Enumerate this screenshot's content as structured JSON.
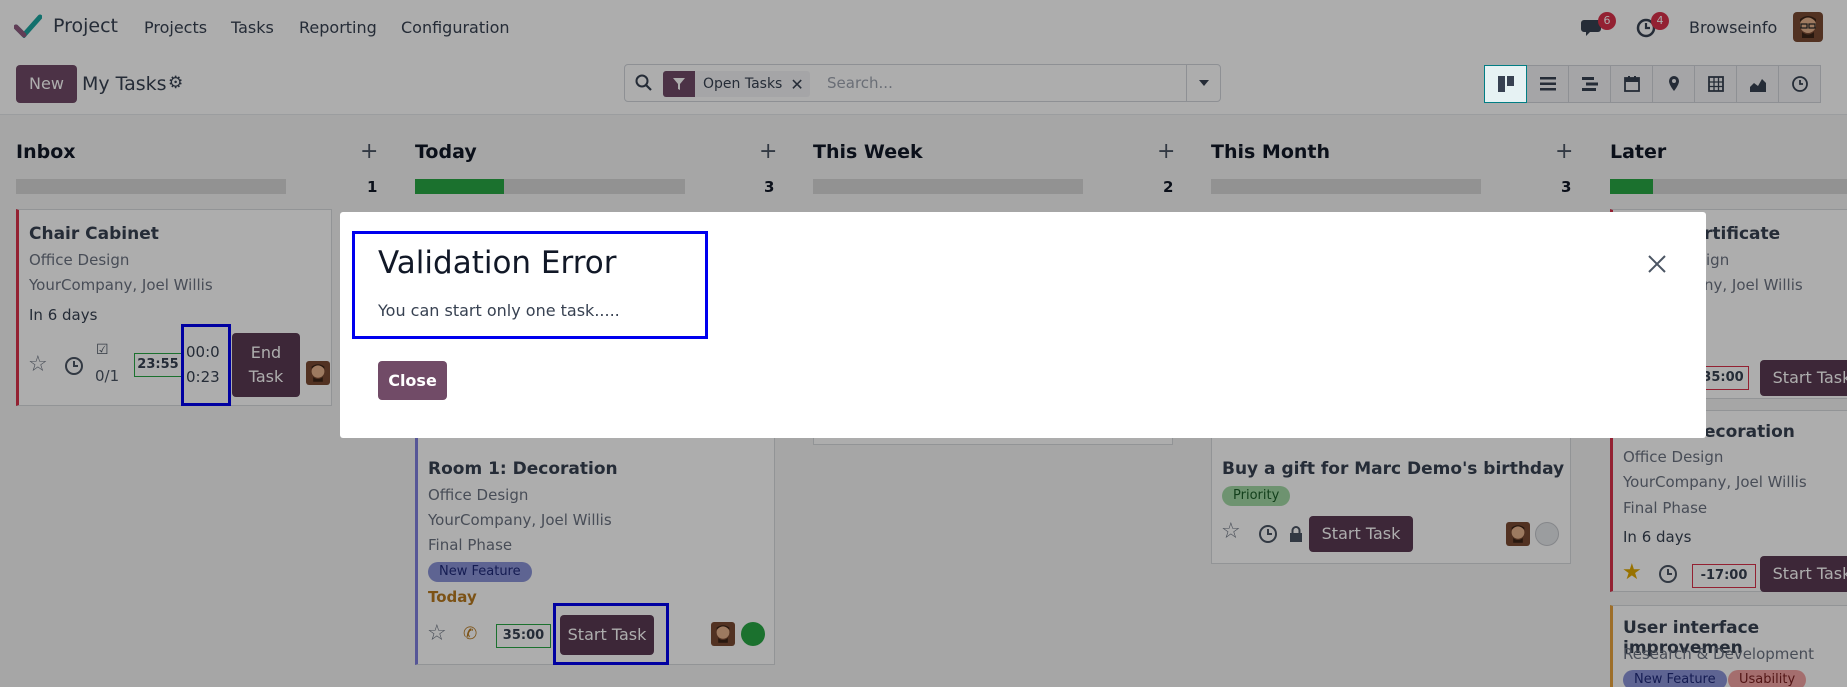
{
  "app": {
    "name": "Project"
  },
  "menu": {
    "items": [
      "Projects",
      "Tasks",
      "Reporting",
      "Configuration"
    ]
  },
  "systray": {
    "messages_count": "6",
    "activities_count": "4",
    "user": "Browseinfo"
  },
  "control": {
    "new_label": "New",
    "title": "My Tasks",
    "search": {
      "facet": "Open Tasks",
      "placeholder": "Search..."
    },
    "views": [
      "kanban",
      "list",
      "gantt",
      "calendar",
      "map",
      "pivot",
      "graph",
      "activity"
    ]
  },
  "columns": [
    {
      "title": "Inbox",
      "count": "1",
      "progress": 0
    },
    {
      "title": "Today",
      "count": "3",
      "progress": 0.33
    },
    {
      "title": "This Week",
      "count": "2",
      "progress": 0
    },
    {
      "title": "This Month",
      "count": "3",
      "progress": 0
    },
    {
      "title": "Later",
      "count": "",
      "progress": 0.18
    }
  ],
  "cards": {
    "chair": {
      "title": "Chair Cabinet",
      "project": "Office Design",
      "customer": "YourCompany, Joel Willis",
      "deadline": "In 6 days",
      "subtasks": "0/1",
      "planned": "23:55",
      "timer_a": "00:0",
      "timer_b": "0:23",
      "end_a": "End",
      "end_b": "Task"
    },
    "room1": {
      "title": "Room 1: Decoration",
      "project": "Office Design",
      "customer": "YourCompany, Joel Willis",
      "stage": "Final Phase",
      "tag": "New Feature",
      "deadline": "Today",
      "planned": "35:00",
      "start": "Start Task"
    },
    "gift": {
      "title": "Buy a gift for Marc Demo's birthday",
      "tag": "Priority",
      "start": "Start Task"
    },
    "later1": {
      "title": "rtificate",
      "project": "ign",
      "customer": "ny, Joel Willis",
      "planned": "35:00",
      "start": "Start Task"
    },
    "later2": {
      "title": "ecoration",
      "project": "Office Design",
      "customer": "YourCompany, Joel Willis",
      "stage": "Final Phase",
      "deadline": "In 6 days",
      "planned": "-17:00",
      "start": "Start Task"
    },
    "later3": {
      "title": "User interface improvemen",
      "project": "Research & Development",
      "tag1": "New Feature",
      "tag2": "Usability"
    }
  },
  "modal": {
    "title": "Validation Error",
    "message": "You can start only one task.....",
    "close_label": "Close"
  },
  "colors": {
    "brand": "#714b67",
    "progress": "#28a745",
    "badge": "#d9324b",
    "highlight": "#0000ee"
  }
}
